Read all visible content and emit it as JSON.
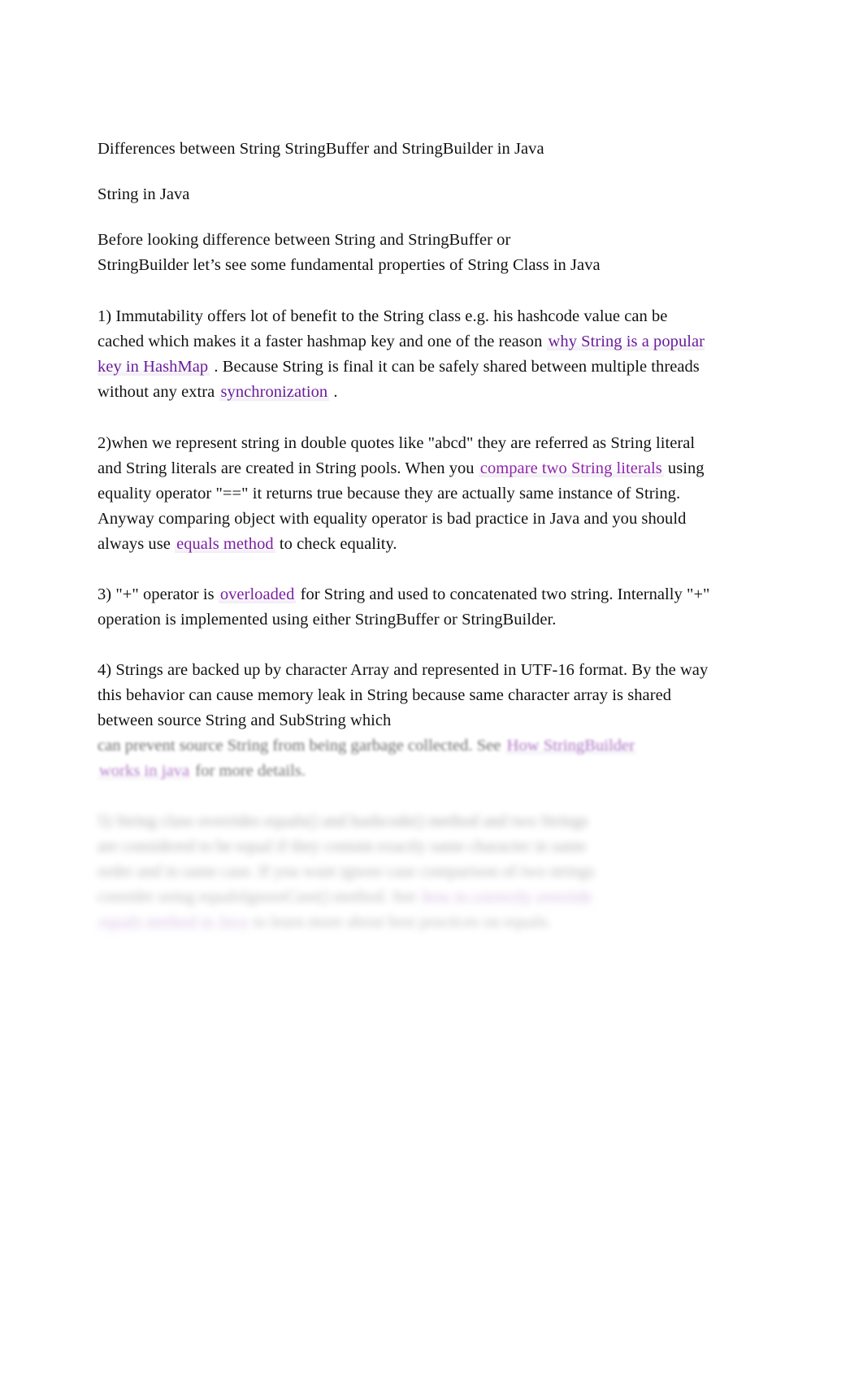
{
  "document": {
    "title": "Differences between String StringBuffer and StringBuilder in Java",
    "subtitle": "String in Java",
    "intro": {
      "line1": "Before looking  difference between String and StringBuffer or",
      "line2": "StringBuilder  let’s see some fundamental properties of String Class in Java"
    },
    "paragraphs": [
      {
        "id": "p1",
        "number": "1)",
        "text_before_link": " Immutability offers lot of benefit to the String class e.g. his hashcode value can be cached which makes it a faster hashmap key and one of the reason ",
        "link1": "why String is a popular key in HashMap",
        "text_middle": " . Because String is final it can be safely shared between multiple threads without any extra ",
        "link2": "synchronization",
        "text_after": " ."
      },
      {
        "id": "p2",
        "number": "2)",
        "text_before_link": "when we represent string in double quotes like \"abcd\" they are referred as String literal and String literals are created in String pools. When you ",
        "link1": "compare two String literals",
        "text_middle": "  using equality operator \"==\" it returns true because they are actually same instance of String. Anyway comparing object with equality operator is bad practice in Java and you should always use ",
        "link2": "equals method",
        "text_after": "  to check equality."
      },
      {
        "id": "p3",
        "number": "3)",
        "text_before_link": " \"+\" operator is ",
        "link1": "overloaded",
        "text_middle": "  for String and used to concatenated two string. Internally \"+\" operation is implemented using either StringBuffer or StringBuilder.",
        "link2": "",
        "text_after": ""
      },
      {
        "id": "p4",
        "number": "4)",
        "text_before_link": " Strings are backed up by character Array and represented in UTF-16 format. By the way this behavior can cause memory leak in String because same character array is shared between source String and SubString which ",
        "link1": "",
        "text_middle": "",
        "link2": "",
        "text_after": ""
      }
    ],
    "faded": {
      "p4_tail_line1": "can prevent source String from being garbage collected. See ",
      "p4_tail_link": "How StringBuilder",
      "p4_tail_link_cont": "works in java",
      "p4_tail_line2": " for more details.",
      "p5_line1": "5) String class overrides equals() and hashcode() method and two Strings",
      "p5_line2": "are considered to be equal if they contain exactly same character in same",
      "p5_line3": "order and in same case. If you want ignore case comparison of two strings",
      "p5_line4": "consider using equalsIgnoreCase() method. See ",
      "p5_link1": "how to correctly override",
      "p5_link2": "equals method in Java",
      "p5_line5": " to learn more about best practices on equals."
    },
    "colors": {
      "link_purple": "#7b1fa2",
      "link_purple_soft": "#8e24aa",
      "text_black": "#121212",
      "page_background": "#ffffff"
    }
  }
}
